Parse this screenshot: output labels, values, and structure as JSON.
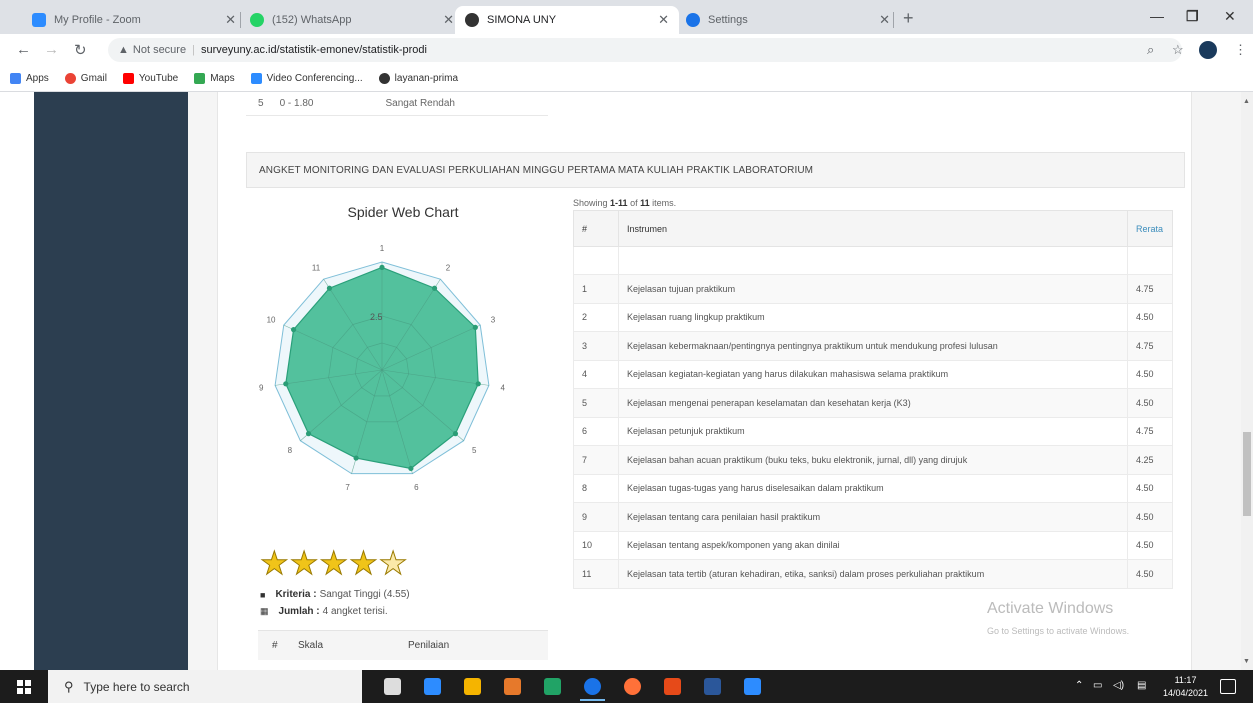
{
  "browser": {
    "tabs": [
      {
        "title": "My Profile - Zoom",
        "color": "#2d8cff",
        "active": false
      },
      {
        "title": "(152) WhatsApp",
        "color": "#25d366",
        "active": false
      },
      {
        "title": "SIMONA UNY",
        "color": "#333333",
        "active": true
      },
      {
        "title": "Settings",
        "color": "#1a73e8",
        "active": false
      }
    ],
    "new_tab": "+",
    "url_warning": "Not secure",
    "url": "surveyuny.ac.id/statistik-emonev/statistik-prodi",
    "bookmarks": [
      {
        "label": "Apps",
        "color": "#4285f4"
      },
      {
        "label": "Gmail",
        "color": "#ea4335"
      },
      {
        "label": "YouTube",
        "color": "#ff0000"
      },
      {
        "label": "Maps",
        "color": "#34a853"
      },
      {
        "label": "Video Conferencing...",
        "color": "#2d8cff"
      },
      {
        "label": "layanan-prima",
        "color": "#333333"
      }
    ]
  },
  "top_row": {
    "no": "5",
    "range": "0 - 1.80",
    "label": "Sangat Rendah"
  },
  "panel": {
    "title": "ANGKET MONITORING DAN EVALUASI PERKULIAHAN MINGGU PERTAMA MATA KULIAH PRAKTIK LABORATORIUM",
    "chart_title": "Spider Web Chart",
    "rating": {
      "stars": 4.5
    },
    "kriteria_label": "Kriteria :",
    "kriteria_value": "Sangat Tinggi (4.55)",
    "jumlah_label": "Jumlah :",
    "jumlah_value": "4 angket terisi.",
    "skala_headers": [
      "#",
      "Skala",
      "Penilaian"
    ]
  },
  "table": {
    "summary_prefix": "Showing ",
    "summary_range": "1-11",
    "summary_of": " of ",
    "summary_total": "11",
    "summary_suffix": " items.",
    "headers": {
      "no": "#",
      "instrumen": "Instrumen",
      "rerata": "Rerata"
    },
    "rows": [
      {
        "no": "1",
        "instrumen": "Kejelasan tujuan praktikum",
        "rerata": "4.75"
      },
      {
        "no": "2",
        "instrumen": "Kejelasan ruang lingkup praktikum",
        "rerata": "4.50"
      },
      {
        "no": "3",
        "instrumen": "Kejelasan kebermaknaan/pentingnya pentingnya praktikum untuk mendukung profesi lulusan",
        "rerata": "4.75"
      },
      {
        "no": "4",
        "instrumen": "Kejelasan kegiatan-kegiatan yang harus dilakukan mahasiswa selama praktikum",
        "rerata": "4.50"
      },
      {
        "no": "5",
        "instrumen": "Kejelasan mengenai penerapan keselamatan dan kesehatan kerja (K3)",
        "rerata": "4.50"
      },
      {
        "no": "6",
        "instrumen": "Kejelasan petunjuk praktikum",
        "rerata": "4.75"
      },
      {
        "no": "7",
        "instrumen": "Kejelasan bahan acuan praktikum (buku teks, buku elektronik, jurnal, dll) yang dirujuk",
        "rerata": "4.25"
      },
      {
        "no": "8",
        "instrumen": "Kejelasan tugas-tugas yang harus diselesaikan dalam praktikum",
        "rerata": "4.50"
      },
      {
        "no": "9",
        "instrumen": "Kejelasan tentang cara penilaian hasil praktikum",
        "rerata": "4.50"
      },
      {
        "no": "10",
        "instrumen": "Kejelasan tentang aspek/komponen yang akan dinilai",
        "rerata": "4.50"
      },
      {
        "no": "11",
        "instrumen": "Kejelasan tata tertib (aturan kehadiran, etika, sanksi) dalam proses perkuliahan praktikum",
        "rerata": "4.50"
      }
    ]
  },
  "chart_data": {
    "type": "radar",
    "title": "Spider Web Chart",
    "categories": [
      "1",
      "2",
      "3",
      "4",
      "5",
      "6",
      "7",
      "8",
      "9",
      "10",
      "11"
    ],
    "series": [
      {
        "values": [
          4.75,
          4.5,
          4.75,
          4.5,
          4.5,
          4.75,
          4.25,
          4.5,
          4.5,
          4.5,
          4.5
        ]
      }
    ],
    "rlim": [
      0,
      5
    ],
    "tick_label": "2.5",
    "fill_color": "#3dba8f",
    "grid_color": "#7fbfd8"
  },
  "watermark": {
    "title": "Activate Windows",
    "subtitle": "Go to Settings to activate Windows."
  },
  "taskbar": {
    "search_placeholder": "Type here to search",
    "time": "11:17",
    "date": "14/04/2021",
    "apps": [
      "#dddddd",
      "#2d8cff",
      "#f5b400",
      "#e6792b",
      "#21a366",
      "#1a73e8",
      "#ff7139",
      "#e64a19",
      "#2b579a",
      "#2d8cff"
    ]
  }
}
